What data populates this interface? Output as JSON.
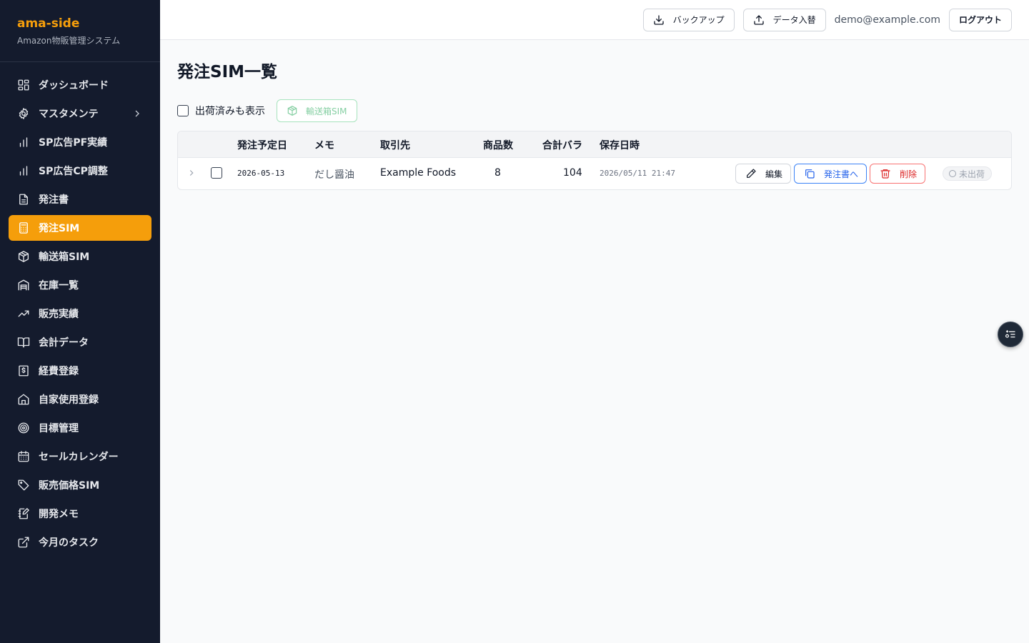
{
  "app": {
    "name": "ama-side",
    "subtitle": "Amazon物販管理システム"
  },
  "sidebar": {
    "items": [
      {
        "label": "ダッシュボード",
        "icon": "dashboard-icon"
      },
      {
        "label": "マスタメンテ",
        "icon": "gear-icon",
        "has_submenu": true
      },
      {
        "label": "SP広告PF実績",
        "icon": "bar-chart-icon"
      },
      {
        "label": "SP広告CP調整",
        "icon": "bar-chart-icon"
      },
      {
        "label": "発注書",
        "icon": "document-icon"
      },
      {
        "label": "発注SIM",
        "icon": "calculator-icon",
        "active": true
      },
      {
        "label": "輸送箱SIM",
        "icon": "box-icon"
      },
      {
        "label": "在庫一覧",
        "icon": "warehouse-icon"
      },
      {
        "label": "販売実績",
        "icon": "trending-up-icon"
      },
      {
        "label": "会計データ",
        "icon": "book-icon"
      },
      {
        "label": "経費登録",
        "icon": "receipt-icon"
      },
      {
        "label": "自家使用登録",
        "icon": "home-icon"
      },
      {
        "label": "目標管理",
        "icon": "target-icon"
      },
      {
        "label": "セールカレンダー",
        "icon": "calendar-icon"
      },
      {
        "label": "販売価格SIM",
        "icon": "tag-icon"
      },
      {
        "label": "開発メモ",
        "icon": "notebook-pen-icon"
      },
      {
        "label": "今月のタスク",
        "icon": "external-link-icon"
      }
    ]
  },
  "header": {
    "backup_label": "バックアップ",
    "import_label": "データ入替",
    "user_email": "demo@example.com",
    "logout_label": "ログアウト"
  },
  "page": {
    "title": "発注SIM一覧",
    "show_shipped_label": "出荷済みも表示",
    "show_shipped_checked": false,
    "shipping_box_button": "輸送箱SIM"
  },
  "table": {
    "columns": [
      "発注予定日",
      "メモ",
      "取引先",
      "商品数",
      "合計バラ",
      "保存日時"
    ],
    "rows": [
      {
        "order_date": "2026-05-13",
        "memo": "だし醤油",
        "supplier": "Example Foods",
        "item_count": "8",
        "total_units": "104",
        "saved_at": "2026/05/11 21:47",
        "edit_label": "編集",
        "to_po_label": "発注書へ",
        "delete_label": "削除",
        "status": "未出荷"
      }
    ]
  },
  "colors": {
    "sidebar_bg": "#141b2d",
    "accent": "#f59e0b",
    "primary_blue": "#2563eb",
    "danger_red": "#dc2626",
    "sim_green": "#86cfa3"
  }
}
